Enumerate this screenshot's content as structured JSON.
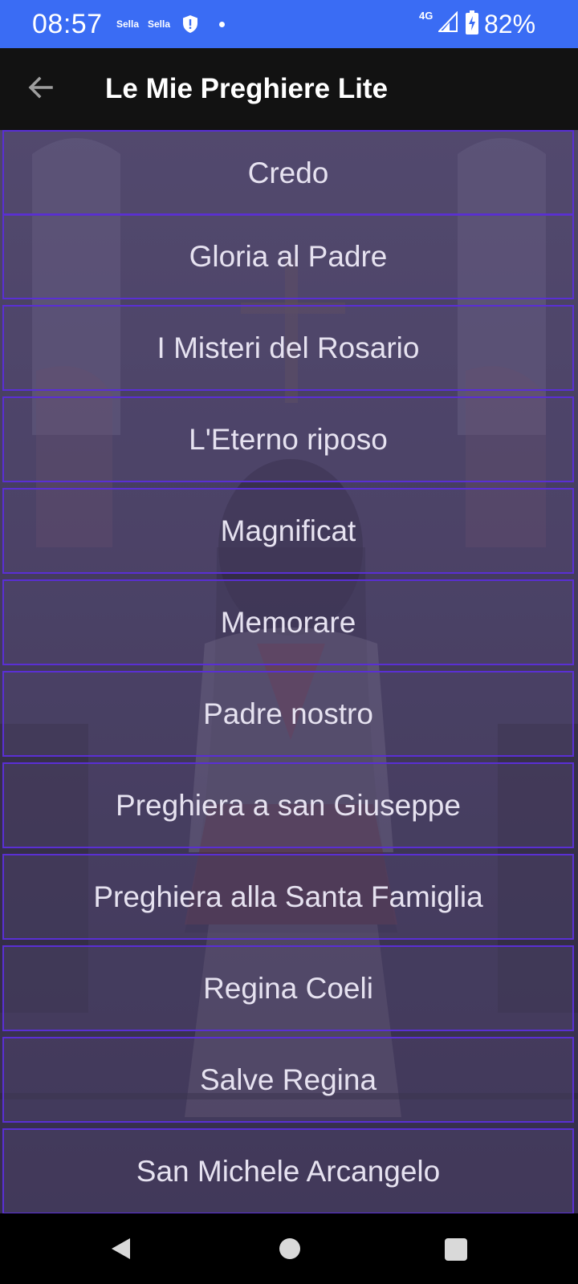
{
  "status_bar": {
    "time": "08:57",
    "carrier_1": "Sella",
    "carrier_2": "Sella",
    "network": "4G",
    "battery": "82%",
    "icons": [
      "shield-icon",
      "notification-dot-icon",
      "signal-icon",
      "battery-charging-icon"
    ],
    "color": "#3a6cf4"
  },
  "app_bar": {
    "title": "Le Mie Preghiere Lite",
    "back_icon": "arrow-back-icon"
  },
  "prayers": [
    {
      "label": "Credo"
    },
    {
      "label": "Gloria al Padre"
    },
    {
      "label": "I Misteri del Rosario"
    },
    {
      "label": "L'Eterno riposo"
    },
    {
      "label": "Magnificat"
    },
    {
      "label": "Memorare"
    },
    {
      "label": "Padre nostro"
    },
    {
      "label": "Preghiera a san Giuseppe"
    },
    {
      "label": "Preghiera alla Santa Famiglia"
    },
    {
      "label": "Regina Coeli"
    },
    {
      "label": "Salve Regina"
    },
    {
      "label": "San Michele Arcangelo"
    }
  ],
  "theme": {
    "item_border": "#5a2fd4",
    "item_text": "#e6e2f0",
    "background": "#463e5f"
  },
  "nav_bar": {
    "icons": [
      "nav-back-icon",
      "nav-home-icon",
      "nav-recents-icon"
    ]
  }
}
